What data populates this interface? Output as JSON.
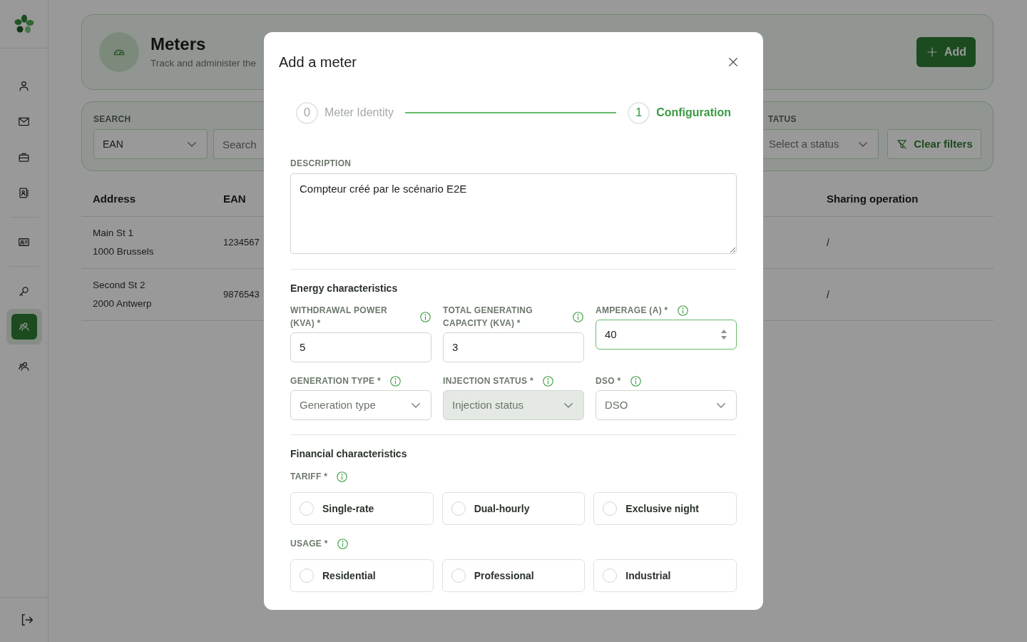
{
  "sidebar": {
    "nav_groups": [
      {
        "items": [
          {
            "selected": false
          },
          {
            "selected": false
          },
          {
            "selected": false
          },
          {
            "selected": false
          }
        ]
      },
      {
        "items": [
          {
            "selected": false
          }
        ]
      },
      {
        "items": [
          {
            "selected": false
          },
          {
            "selected": true
          },
          {
            "selected": false
          }
        ]
      }
    ]
  },
  "header": {
    "title": "Meters",
    "subtitle": "Track and administer the",
    "add_button": "Add"
  },
  "filters": {
    "search_label": "SEARCH",
    "search_by": "EAN",
    "search_placeholder": "Search",
    "status_label": "TATUS",
    "status_placeholder": "Select a status",
    "clear_button": "Clear filters"
  },
  "table": {
    "columns": [
      "Address",
      "EAN",
      "Sharing operation"
    ],
    "rows": [
      {
        "address": [
          "Main St 1",
          "1000 Brussels"
        ],
        "ean": "1234567",
        "sharing_operation": "/"
      },
      {
        "address": [
          "Second St 2",
          "2000 Antwerp"
        ],
        "ean": "9876543",
        "sharing_operation": "/"
      }
    ]
  },
  "modal": {
    "title": "Add a meter",
    "steps": [
      {
        "number": "0",
        "label": "Meter Identity",
        "selected": false
      },
      {
        "number": "1",
        "label": "Configuration",
        "selected": true
      }
    ],
    "description": {
      "label": "DESCRIPTION",
      "value": "Compteur créé par le scénario E2E"
    },
    "energy": {
      "title": "Energy characteristics",
      "fields": [
        {
          "kind": "input",
          "label": "WITHDRAWAL POWER (KVA) *",
          "value": "5",
          "focused": false
        },
        {
          "kind": "input",
          "label": "TOTAL GENERATING CAPACITY (KVA) *",
          "value": "3",
          "focused": false
        },
        {
          "kind": "number",
          "label": "AMPERAGE (A) *",
          "value": "40",
          "focused": true
        },
        {
          "kind": "select",
          "label": "GENERATION TYPE *",
          "placeholder": "Generation type",
          "disabled": false
        },
        {
          "kind": "select",
          "label": "INJECTION STATUS *",
          "placeholder": "Injection status",
          "disabled": true
        },
        {
          "kind": "select",
          "label": "DSO *",
          "placeholder": "DSO",
          "disabled": false
        }
      ]
    },
    "financial": {
      "title": "Financial characteristics",
      "groups": [
        {
          "label": "TARIFF *",
          "options": [
            {
              "label": "Single-rate",
              "selected": false
            },
            {
              "label": "Dual-hourly",
              "selected": false
            },
            {
              "label": "Exclusive night",
              "selected": false
            }
          ]
        },
        {
          "label": "USAGE *",
          "options": [
            {
              "label": "Residential",
              "selected": false
            },
            {
              "label": "Professional",
              "selected": false
            },
            {
              "label": "Industrial",
              "selected": false
            }
          ]
        }
      ]
    }
  }
}
